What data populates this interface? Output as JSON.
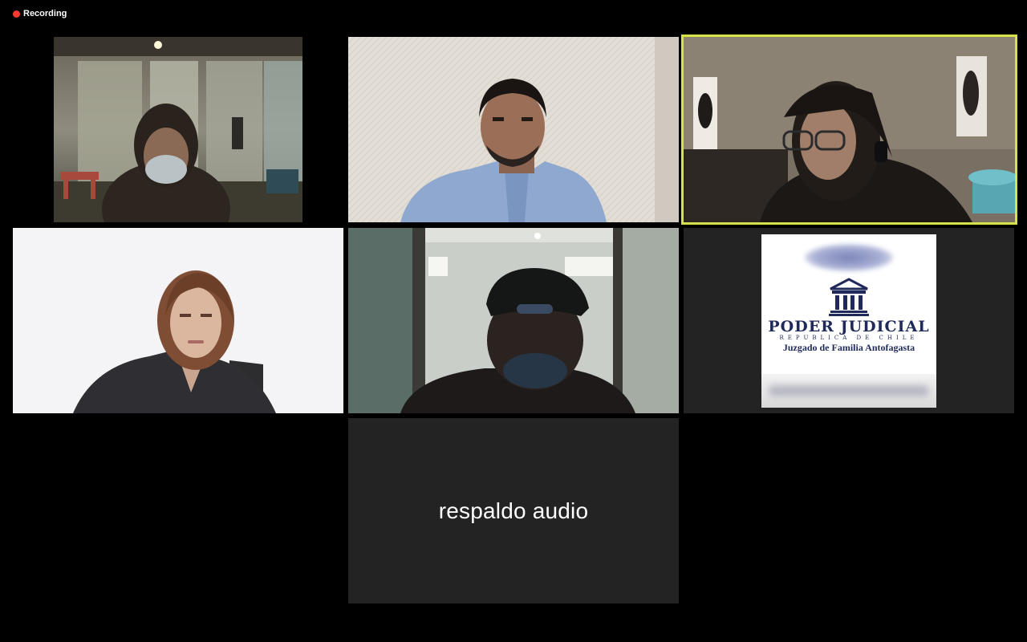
{
  "recording": {
    "label": "Recording",
    "color": "#ff3b30"
  },
  "participants": [
    {
      "kind": "video",
      "description_icon": "masked-woman-video"
    },
    {
      "kind": "video",
      "description_icon": "man-blue-shirt-video"
    },
    {
      "kind": "video",
      "description_icon": "woman-glasses-headset-video",
      "active_speaker": true
    },
    {
      "kind": "video",
      "description_icon": "woman-dark-sweater-video"
    },
    {
      "kind": "video",
      "description_icon": "man-cap-dark-video"
    },
    {
      "kind": "logo",
      "logo": {
        "title": "PODER JUDICIAL",
        "subtitle": "REPUBLICA DE CHILE",
        "court": "Juzgado de Familia Antofagasta"
      }
    },
    {
      "kind": "name",
      "name": "respaldo audio"
    }
  ],
  "colors": {
    "background": "#000000",
    "tile": "#232323",
    "active_border": "#d6e24a",
    "logo_navy": "#1f2a5a"
  }
}
